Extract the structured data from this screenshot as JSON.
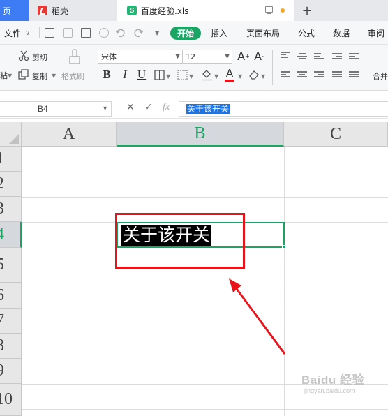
{
  "tabs": {
    "home": "页",
    "daoke": "稻壳",
    "file": "百度经验.xls",
    "file_logo": "S",
    "add": "+"
  },
  "menu": {
    "file": "文件",
    "file_caret": "∨",
    "items": [
      "开始",
      "插入",
      "页面布局",
      "公式",
      "数据",
      "审阅"
    ]
  },
  "ribbon": {
    "paste": "粘",
    "cut": "剪切",
    "copy": "复制",
    "format_painter": "格式刷",
    "font_name": "宋体",
    "font_size": "12",
    "merge": "合并"
  },
  "formula_bar": {
    "cell_ref": "B4",
    "content": "关于该开关",
    "cancel": "✕",
    "confirm": "✓",
    "fx": "fx"
  },
  "grid": {
    "columns": [
      "A",
      "B",
      "C"
    ],
    "rows": [
      "1",
      "2",
      "3",
      "4",
      "5",
      "6",
      "7",
      "8",
      "9",
      "10"
    ],
    "active_column": "B",
    "active_row": "4",
    "cell_b4": "关于该开关"
  },
  "watermark": {
    "main": "Baidu 经验",
    "url": "jingyan.baidu.com"
  },
  "colors": {
    "accent": "#1aa565",
    "tab_home": "#3d7cf4",
    "annotation": "#e8141b",
    "selection": "#1a73e8"
  },
  "icons": [
    "monitor-icon",
    "status-dot-icon",
    "save-icon",
    "print-icon",
    "undo-icon",
    "redo-icon",
    "scissors-icon",
    "copy-icon",
    "brush-icon",
    "bold-icon",
    "italic-icon",
    "underline-icon",
    "border-icon",
    "fill-icon",
    "font-color-icon",
    "eraser-icon",
    "align-icon",
    "cancel-icon",
    "confirm-icon",
    "fx-icon",
    "select-all-icon",
    "arrow-icon"
  ]
}
